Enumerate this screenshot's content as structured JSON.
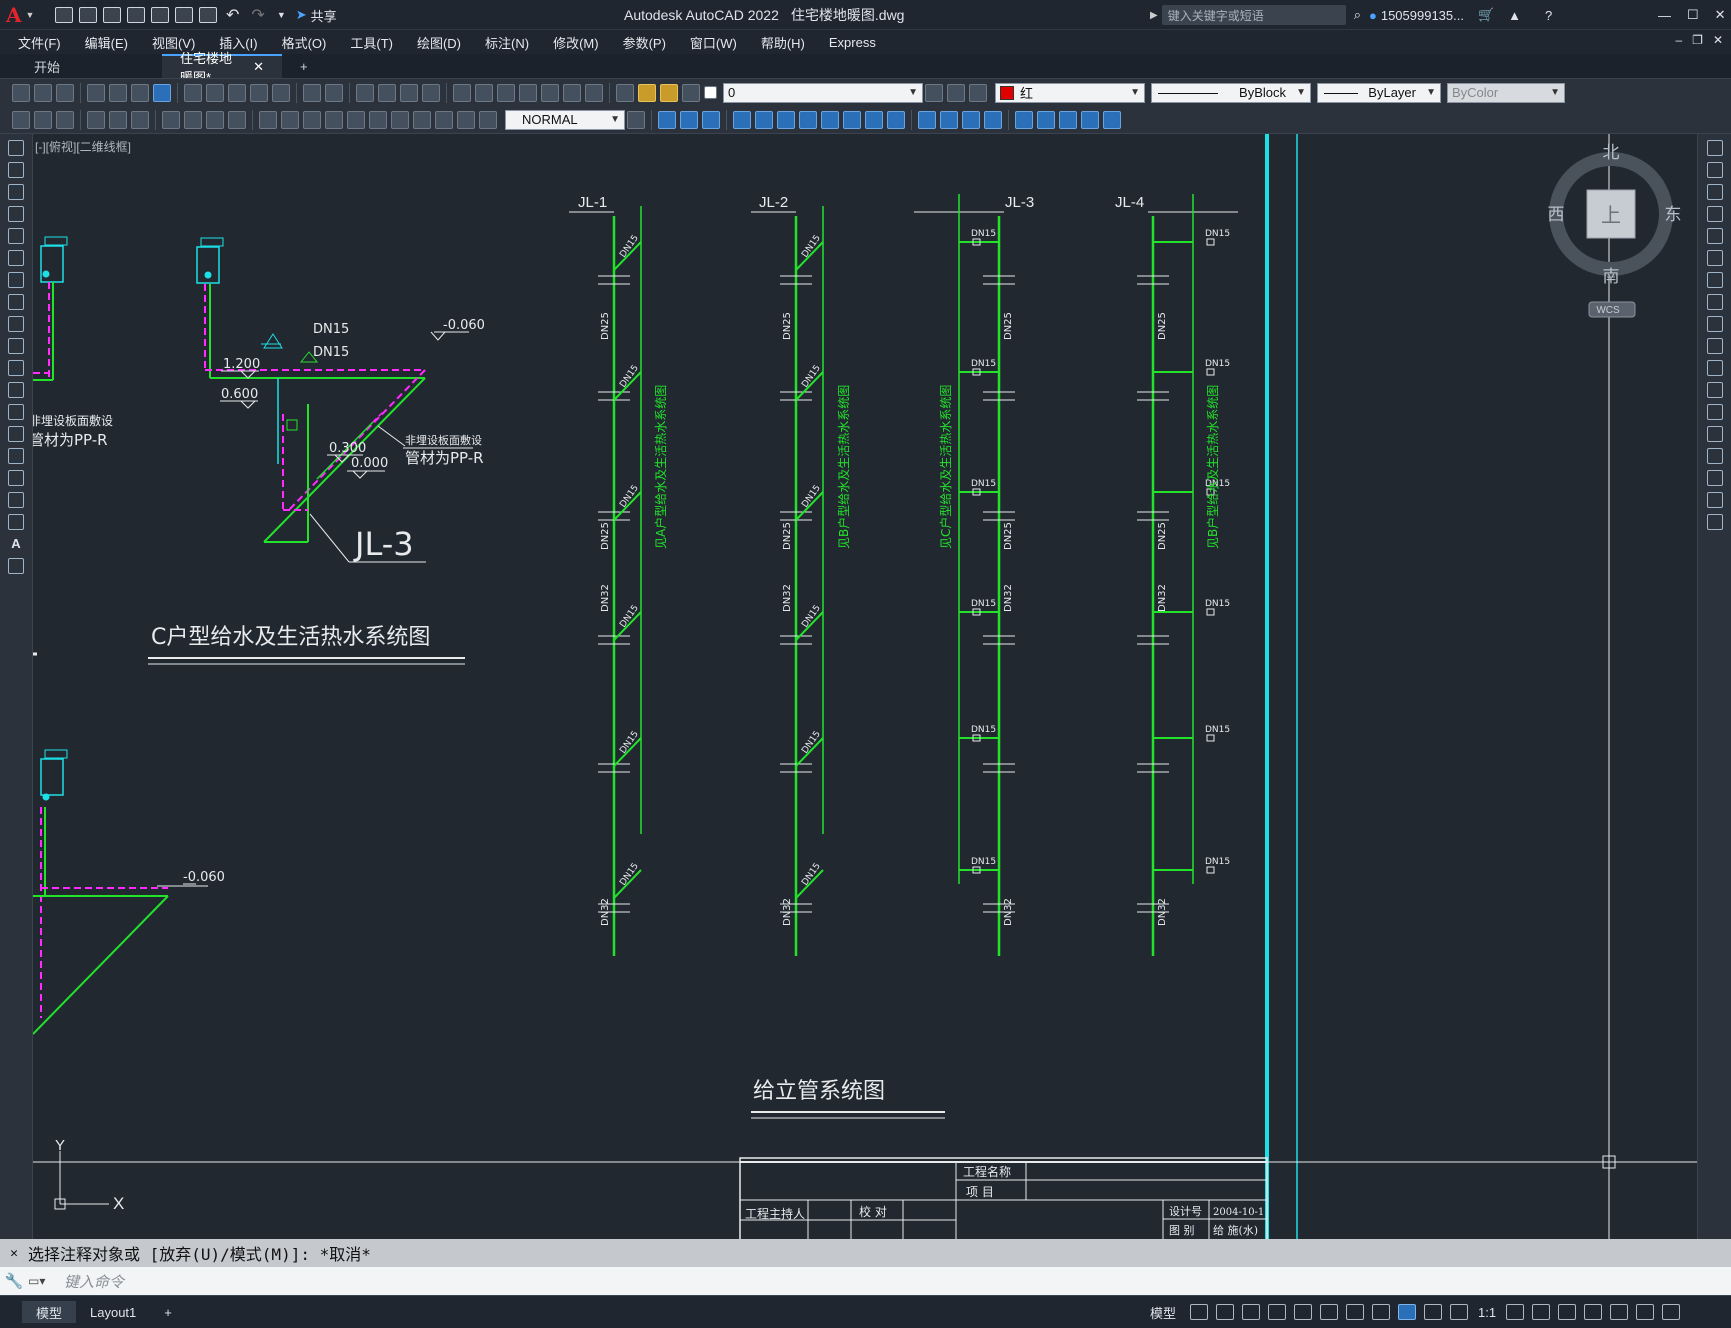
{
  "app": {
    "title": "Autodesk AutoCAD 2022",
    "filename": "住宅楼地暖图.dwg",
    "share_label": "共享",
    "search_placeholder": "键入关键字或短语",
    "user": "1505999135...",
    "logo": "A"
  },
  "menu": [
    "文件(F)",
    "编辑(E)",
    "视图(V)",
    "插入(I)",
    "格式(O)",
    "工具(T)",
    "绘图(D)",
    "标注(N)",
    "修改(M)",
    "参数(P)",
    "窗口(W)",
    "帮助(H)",
    "Express"
  ],
  "tabs": [
    {
      "label": "开始"
    },
    {
      "label": "住宅楼地暖图*"
    }
  ],
  "properties": {
    "layer": "0",
    "color_name": "红",
    "linetype": "ByBlock",
    "lineweight": "ByLayer",
    "plotstyle": "ByColor",
    "textstyle": "NORMAL"
  },
  "viewport_label": "[-][俯视][二维线框]",
  "viewcube": {
    "north": "北",
    "south": "南",
    "east": "东",
    "west": "西",
    "top": "上",
    "wcs": "WCS"
  },
  "drawing": {
    "riser_labels": [
      "JL-1",
      "JL-2",
      "JL-3",
      "JL-4"
    ],
    "dn15": "DN15",
    "dn25": "DN25",
    "dn32": "DN32",
    "riser_title": "给立管系统图",
    "system_title": "C户型给水及生活热水系统图",
    "jl3_big": "JL-3",
    "elev_1": "-0.060",
    "elev_2": "1.200",
    "elev_3": "0.600",
    "elev_4": "0.300",
    "elev_5": "0.000",
    "elev_6": "-0.060",
    "note_a": "非埋设板面敷设",
    "note_b": "管材为PP-R",
    "note_a_left": "非埋设板面敷设",
    "note_b_left": "管材为PP-R",
    "ref_a": "见A户型给水及生活热水系统图",
    "ref_b": "见B户型给水及生活热水系统图",
    "ref_c": "见C户型给水及生活热水系统图",
    "ref_b2": "见B户型给水及生活热水系统图",
    "ucs_x": "X",
    "ucs_y": "Y"
  },
  "title_block": {
    "project_name": "工程名称",
    "item": "项      目",
    "leader": "工程主持人",
    "check": "校   对",
    "design_no": "设计号",
    "date": "2004-10-1",
    "drawing": "图   别",
    "sheet": "给 施(水)"
  },
  "command": {
    "history": "选择注释对象或 [放弃(U)/模式(M)]: *取消*",
    "placeholder": "键入命令"
  },
  "status": {
    "model_tab": "模型",
    "layout_tab": "Layout1",
    "model_btn": "模型",
    "scale": "1:1"
  },
  "colors": {
    "pipe_green": "#22e22a",
    "pipe_magenta": "#ff2bff",
    "cyan": "#1de0e6",
    "background": "#212830",
    "white": "#e8eaec"
  }
}
